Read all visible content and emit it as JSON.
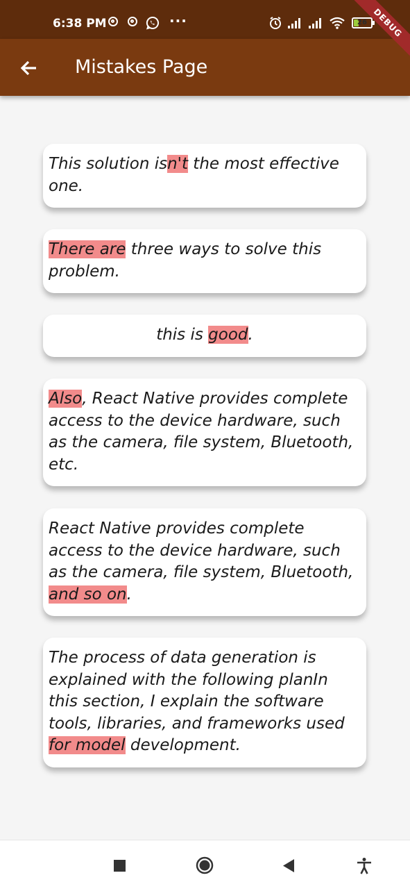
{
  "status_bar": {
    "time": "6:38 PM",
    "battery": "26",
    "debug_label": "DEBUG",
    "icons": [
      "sync-icon",
      "sync-icon",
      "whatsapp-icon",
      "more-icon",
      "alarm-icon",
      "signal-icon",
      "signal-icon",
      "wifi-icon",
      "battery-icon"
    ]
  },
  "app_bar": {
    "title": "Mistakes Page",
    "back_icon": "arrow-back-icon"
  },
  "cards": [
    {
      "segments": [
        {
          "text": "This solution is",
          "highlight": false
        },
        {
          "text": "n't",
          "highlight": true
        },
        {
          "text": " the most effective one.",
          "highlight": false
        }
      ]
    },
    {
      "segments": [
        {
          "text": "There are",
          "highlight": true
        },
        {
          "text": " three ways to solve this problem.",
          "highlight": false
        }
      ]
    },
    {
      "segments": [
        {
          "text": "this is ",
          "highlight": false
        },
        {
          "text": "good",
          "highlight": true
        },
        {
          "text": ".",
          "highlight": false
        }
      ]
    },
    {
      "segments": [
        {
          "text": "Also",
          "highlight": true
        },
        {
          "text": ", React Native provides complete access to the device hardware, such as the camera, file system, Bluetooth, etc.",
          "highlight": false
        }
      ]
    },
    {
      "segments": [
        {
          "text": "React Native provides complete access to the device hardware, such as the camera, file system, Bluetooth, ",
          "highlight": false
        },
        {
          "text": "and so on",
          "highlight": true
        },
        {
          "text": ".",
          "highlight": false
        }
      ]
    },
    {
      "segments": [
        {
          "text": "The process of data generation is explained with the following planIn this section, I explain the software tools, libraries, and frameworks used ",
          "highlight": false
        },
        {
          "text": "for model",
          "highlight": true
        },
        {
          "text": " development.",
          "highlight": false
        }
      ]
    }
  ],
  "colors": {
    "status_bar": "#5e2c0c",
    "app_bar": "#7a3a10",
    "highlight": "#f28b8b",
    "background": "#f5f5f5"
  },
  "bottom_nav": {
    "buttons": [
      "recents-square-icon",
      "home-circle-icon",
      "back-triangle-icon",
      "accessibility-icon"
    ]
  }
}
